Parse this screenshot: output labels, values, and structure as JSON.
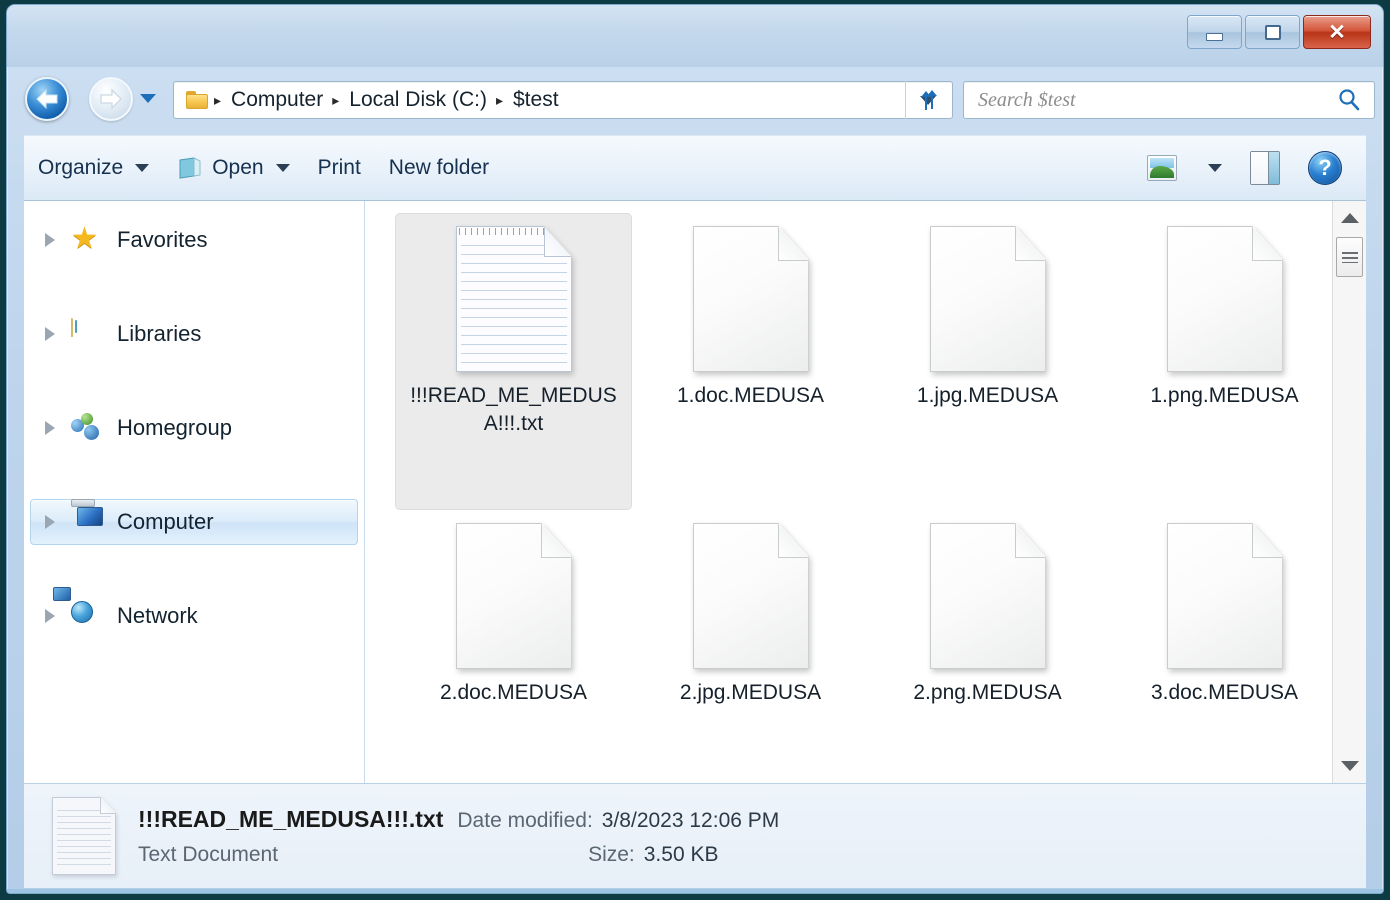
{
  "window": {
    "controls": {
      "minimize_label": "–",
      "maximize_label": "",
      "close_label": "✕"
    }
  },
  "address": {
    "folder_icon": "folder-icon",
    "separator": "▸",
    "breadcrumbs": [
      "Computer",
      "Local Disk (C:)",
      "$test"
    ],
    "dropdown_icon": "chevron-down-icon",
    "refresh_icon": "refresh-icon"
  },
  "search": {
    "placeholder": "Search $test",
    "icon": "search-icon"
  },
  "toolbar": {
    "organize_label": "Organize",
    "open_label": "Open",
    "print_label": "Print",
    "new_folder_label": "New folder",
    "view_icon": "view-layout-icon",
    "view_dropdown_icon": "chevron-down-icon",
    "preview_pane_icon": "preview-pane-icon",
    "help_label": "?"
  },
  "sidebar": {
    "items": [
      {
        "label": "Favorites",
        "icon": "star-icon",
        "selected": false
      },
      {
        "label": "Libraries",
        "icon": "libraries-icon",
        "selected": false
      },
      {
        "label": "Homegroup",
        "icon": "homegroup-icon",
        "selected": false
      },
      {
        "label": "Computer",
        "icon": "computer-icon",
        "selected": true
      },
      {
        "label": "Network",
        "icon": "network-icon",
        "selected": false
      }
    ]
  },
  "files": [
    {
      "name": "!!!READ_ME_MEDUSA!!!.txt",
      "icon": "text-document-icon",
      "selected": true
    },
    {
      "name": "1.doc.MEDUSA",
      "icon": "generic-file-icon",
      "selected": false
    },
    {
      "name": "1.jpg.MEDUSA",
      "icon": "generic-file-icon",
      "selected": false
    },
    {
      "name": "1.png.MEDUSA",
      "icon": "generic-file-icon",
      "selected": false
    },
    {
      "name": "2.doc.MEDUSA",
      "icon": "generic-file-icon",
      "selected": false
    },
    {
      "name": "2.jpg.MEDUSA",
      "icon": "generic-file-icon",
      "selected": false
    },
    {
      "name": "2.png.MEDUSA",
      "icon": "generic-file-icon",
      "selected": false
    },
    {
      "name": "3.doc.MEDUSA",
      "icon": "generic-file-icon",
      "selected": false
    }
  ],
  "details": {
    "file_name": "!!!READ_ME_MEDUSA!!!.txt",
    "date_modified_label": "Date modified:",
    "date_modified_value": "3/8/2023 12:06 PM",
    "file_type": "Text Document",
    "size_label": "Size:",
    "size_value": "3.50 KB",
    "icon": "text-document-icon"
  },
  "scrollbar": {
    "up_icon": "scroll-up-arrow-icon",
    "down_icon": "scroll-down-arrow-icon"
  },
  "colors": {
    "frame": "#b4cde8",
    "selection": "#ebebeb",
    "nav_selection": "#cfe4f8",
    "close_button": "#c0391c",
    "accent": "#1f6fb8"
  }
}
